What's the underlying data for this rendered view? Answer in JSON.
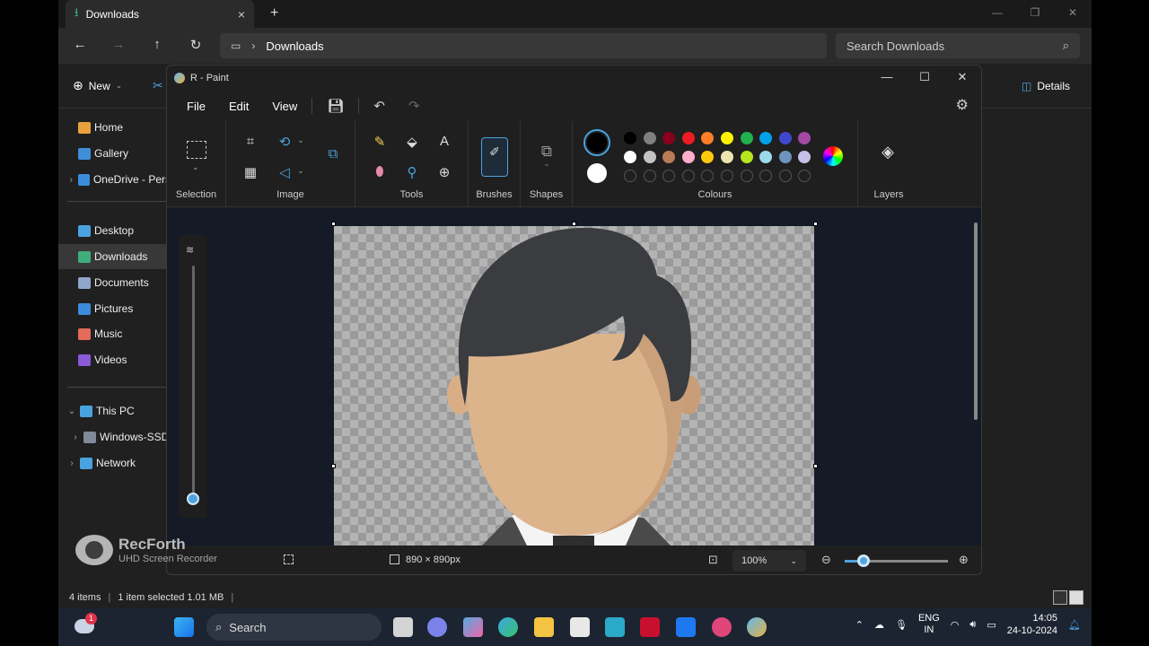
{
  "explorer": {
    "tab_title": "Downloads",
    "address_crumb": "Downloads",
    "search_placeholder": "Search Downloads",
    "new_label": "New",
    "details_label": "Details",
    "sidebar": [
      {
        "label": "Home",
        "color": "#e9a23b"
      },
      {
        "label": "Gallery",
        "color": "#3f8fd8"
      },
      {
        "label": "OneDrive - Pers",
        "color": "#3b8ddb"
      },
      {
        "label": "Desktop",
        "color": "#4aa3df"
      },
      {
        "label": "Downloads",
        "color": "#3fae7a"
      },
      {
        "label": "Documents",
        "color": "#8fa7c8"
      },
      {
        "label": "Pictures",
        "color": "#3b8ddb"
      },
      {
        "label": "Music",
        "color": "#e46a5a"
      },
      {
        "label": "Videos",
        "color": "#8a5ad8"
      },
      {
        "label": "This PC",
        "color": "#4aa3df"
      },
      {
        "label": "Windows-SSD",
        "color": "#7f8b99"
      },
      {
        "label": "Network",
        "color": "#4aa3df"
      }
    ],
    "status": {
      "items": "4 items",
      "selected": "1 item selected  1.01 MB"
    }
  },
  "paint": {
    "title": "R - Paint",
    "menu": {
      "file": "File",
      "edit": "Edit",
      "view": "View"
    },
    "groups": {
      "selection": "Selection",
      "image": "Image",
      "tools": "Tools",
      "brushes": "Brushes",
      "shapes": "Shapes",
      "colours": "Colours",
      "layers": "Layers"
    },
    "palette_row1": [
      "#000000",
      "#7f7f7f",
      "#88001b",
      "#ed1c24",
      "#ff7f27",
      "#fff200",
      "#22b14c",
      "#00a2e8",
      "#3f48cc",
      "#a349a4"
    ],
    "palette_row2": [
      "#ffffff",
      "#c3c3c3",
      "#b97a57",
      "#ffaec9",
      "#ffc90e",
      "#efe4b0",
      "#b5e61d",
      "#99d9ea",
      "#7092be",
      "#c8bfe7"
    ],
    "status": {
      "dimensions": "890 × 890px",
      "zoom": "100%"
    }
  },
  "watermark": {
    "title": "RecForth",
    "subtitle": "UHD Screen Recorder"
  },
  "taskbar": {
    "search_label": "Search",
    "notification_badge": "1",
    "lang_top": "ENG",
    "lang_bottom": "IN",
    "time": "14:05",
    "date": "24-10-2024"
  }
}
